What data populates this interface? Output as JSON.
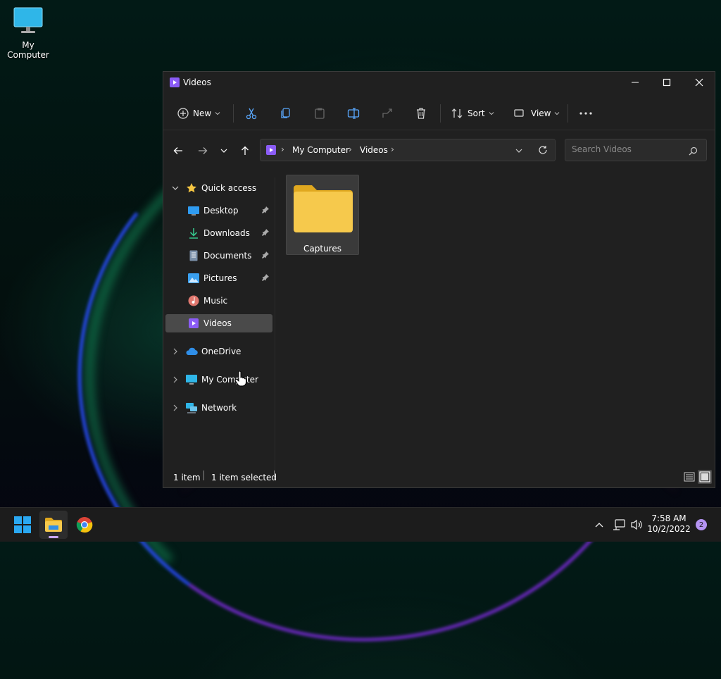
{
  "desktop": {
    "icon_label": "My Computer"
  },
  "window": {
    "title": "Videos",
    "toolbar": {
      "new_label": "New",
      "sort_label": "Sort",
      "view_label": "View"
    },
    "address": {
      "crumbs": [
        "My Computer",
        "Videos"
      ]
    },
    "search": {
      "placeholder": "Search Videos"
    },
    "sidebar": {
      "quick_access": "Quick access",
      "items": [
        {
          "label": "Desktop",
          "pinned": true
        },
        {
          "label": "Downloads",
          "pinned": true
        },
        {
          "label": "Documents",
          "pinned": true
        },
        {
          "label": "Pictures",
          "pinned": true
        },
        {
          "label": "Music",
          "pinned": false
        },
        {
          "label": "Videos",
          "pinned": false,
          "selected": true
        }
      ],
      "roots": [
        "OneDrive",
        "My Computer",
        "Network"
      ]
    },
    "content": {
      "items": [
        {
          "name": "Captures",
          "type": "folder"
        }
      ]
    },
    "status": {
      "count": "1 item",
      "selected": "1 item selected"
    }
  },
  "taskbar": {
    "time": "7:58 AM",
    "date": "10/2/2022",
    "notification_count": "2"
  },
  "colors": {
    "window_bg": "#202020",
    "selected_bg": "#4a4a4a",
    "folder": "#f6c94c",
    "video_purple": "#8b5cf6",
    "accent_blue": "#2f9bf0"
  }
}
